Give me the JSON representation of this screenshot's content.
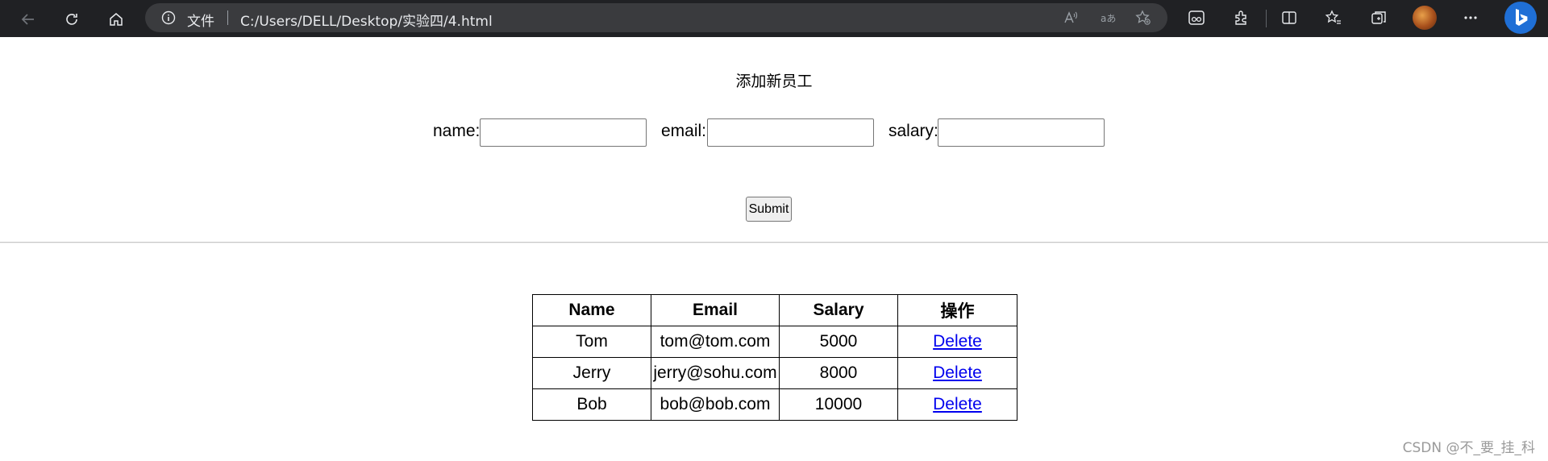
{
  "browser": {
    "address_scheme": "文件",
    "address_url": "C:/Users/DELL/Desktop/实验四/4.html"
  },
  "page": {
    "form_title": "添加新员工",
    "fields": {
      "name_label": "name:",
      "name_value": "",
      "email_label": "email:",
      "email_value": "",
      "salary_label": "salary:",
      "salary_value": ""
    },
    "submit_label": "Submit"
  },
  "table": {
    "headers": [
      "Name",
      "Email",
      "Salary",
      "操作"
    ],
    "rows": [
      {
        "name": "Tom",
        "email": "tom@tom.com",
        "salary": "5000",
        "action": "Delete"
      },
      {
        "name": "Jerry",
        "email": "jerry@sohu.com",
        "salary": "8000",
        "action": "Delete"
      },
      {
        "name": "Bob",
        "email": "bob@bob.com",
        "salary": "10000",
        "action": "Delete"
      }
    ]
  },
  "watermark": "CSDN @不_要_挂_科",
  "colors": {
    "toolbar_bg": "#202124",
    "address_bg": "#3a3b3e",
    "link": "#0000ee"
  }
}
